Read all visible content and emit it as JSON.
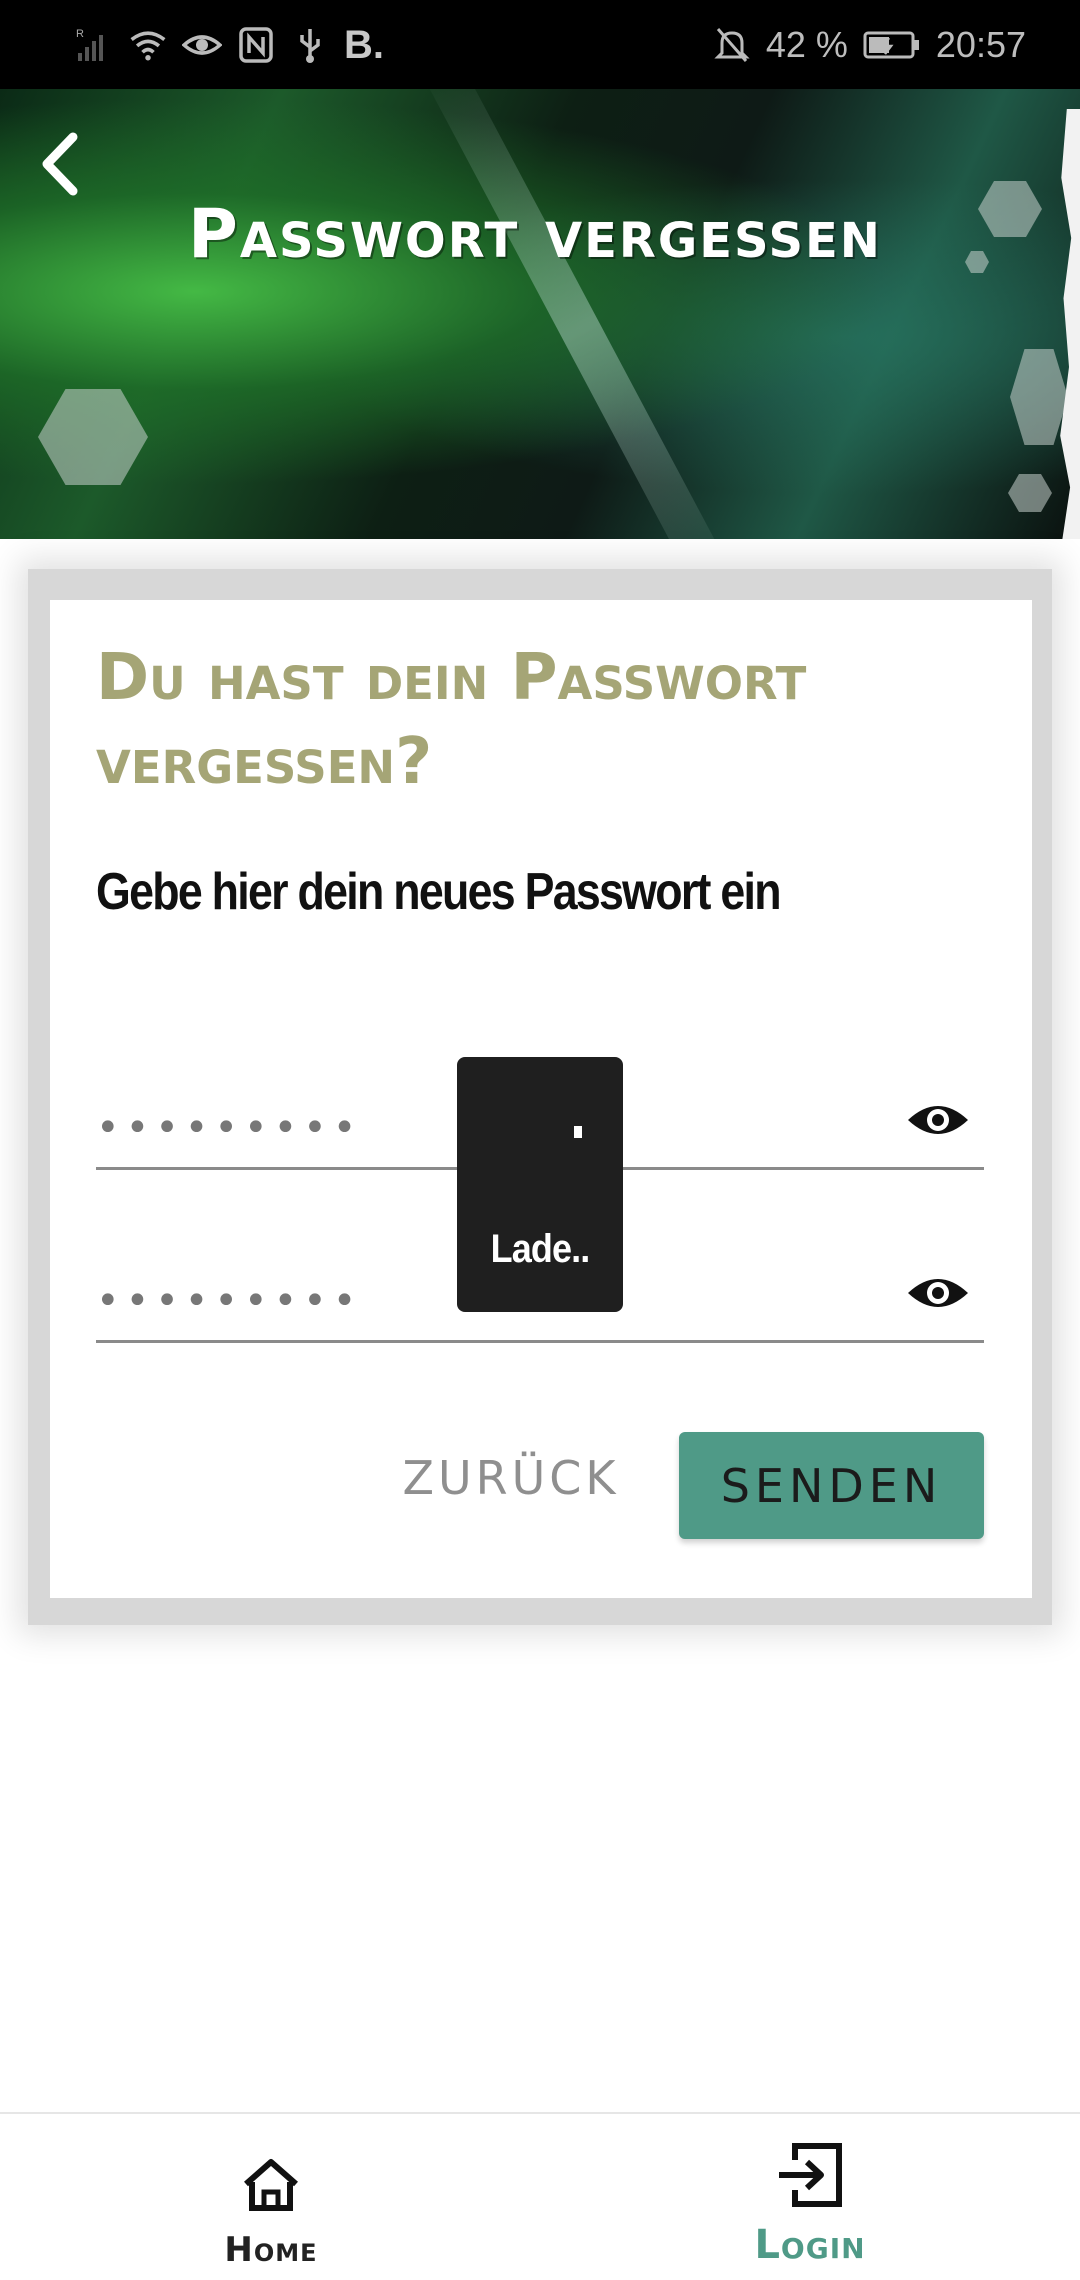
{
  "status_bar": {
    "left_icons": [
      "signal-icon",
      "wifi-icon",
      "eye-icon",
      "nfc-icon",
      "usb-icon",
      "b-icon"
    ],
    "b_label": "B.",
    "battery_percent": "42 %",
    "time": "20:57"
  },
  "header": {
    "title": "Passwort vergessen"
  },
  "card": {
    "title": "Du hast dein Passwort vergessen?",
    "subtitle": "Gebe hier dein neues Passwort ein",
    "password_mask": "•••••••••",
    "confirm_mask": "•••••••••",
    "back_label": "ZURÜCK",
    "send_label": "SENDEN"
  },
  "loader": {
    "text": "Lade.."
  },
  "bottom_nav": {
    "items": [
      {
        "label": "Home",
        "icon": "home-icon"
      },
      {
        "label": "Login",
        "icon": "login-icon"
      }
    ]
  },
  "colors": {
    "accent": "#4f9a87",
    "title_olive": "#a5a576"
  }
}
